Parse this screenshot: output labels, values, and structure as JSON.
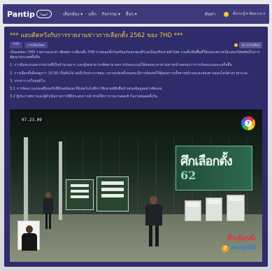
{
  "nav": {
    "brand": "Pantip",
    "links": [
      "เลือกห้อง ▾",
      "แท็ก",
      "กิจกรรม ▾",
      "อื่นๆ ▾"
    ],
    "search": "ค้นหา",
    "user": "ตั้งกระทู้ ▾  ข้อความ  ▾"
  },
  "post": {
    "title": "*** แอบติดหวังกับการรายงานข่าวการเลือกตั้ง 2562 ของ 7HD ***",
    "tags": [
      "7HD",
      "การเมืองไทย"
    ],
    "tag_right": "ข่าวการเมือง",
    "paragraphs": [
      "เห็นแต่ช่อง 7HD รายงานและข่าวพิเศษการเลือกตั้ง 7HD ถ่ายทอดทั้งวันพร้อมกันทุกช่องที่ร่วมเป็นเครือข่ายทั่วไทย รวมทั้งเปิดพื้นที่ให้แต่ละพรรคได้แสดงวิสัยทัศน์ในการพัฒนาประเทศทั้งคืน",
      "1. การนับคะแนนจากหน่วยที่เป็นจำนวนมาก และผู้ชมสามารถติดตาม ผลการนับคะแนนได้ตลอดเวลาผ่านทางหน้าจอจนกว่าการนับคะแนนจะเสร็จสิ้น",
      "2. การเลือกตั้งมีคนดูกว่า 10.00 เป็นต้นไป จนถึงวันประกาศผล เวลาสรุปผลทั้งหมดจะมีการอัพเดตให้ผู้ชมทราบทั้งทางหน้าจอและช่องทางออนไลน์ต่างๆ ทุกระยะ",
      "3. บรรยากาศในสตูดิโอ",
      "3.1 การจัดฉากแบบเสมือนจริงที่ทันสมัยและใช้เทคโนโลยีกราฟิกสามมิติเพื่อนำเสนอข้อมูลอย่างชัดเจน",
      "3.2 ผู้ประกาศข่าวและผู้ดำเนินรายการที่มีประสบการณ์ ช่วยให้การรายงานผลเข้าใจง่ายตลอดทั้งวัน"
    ]
  },
  "video": {
    "timestamp": "07.23.09",
    "channel": "7",
    "wall_line1": "ศึกเลือกตั้ง",
    "wall_line2": "62",
    "headline1": "ศึกเลือกตั้ง",
    "headline2": "ครบทุกมิติ"
  }
}
